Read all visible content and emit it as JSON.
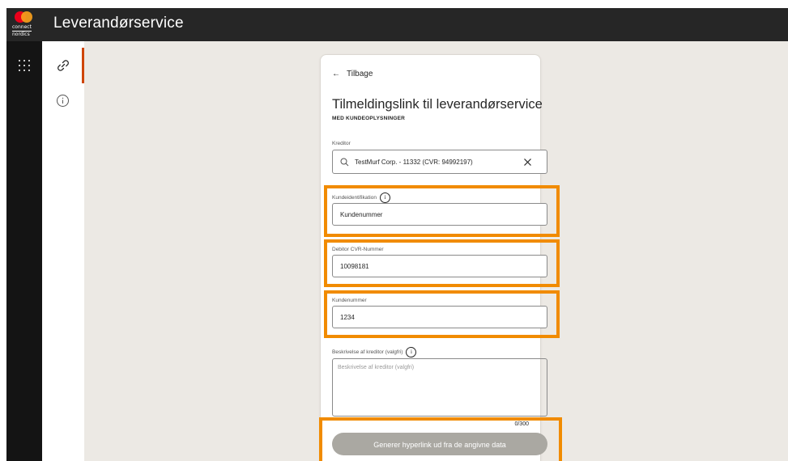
{
  "brand": {
    "line1": "connect",
    "line2": "nordics"
  },
  "app_title": "Leverandørservice",
  "colors": {
    "accent": "#cf4500",
    "highlight": "#f18b00",
    "button_disabled": "#aaa8a2"
  },
  "sidebar": {
    "items": [
      {
        "icon": "link-icon",
        "active": true
      },
      {
        "icon": "info-icon",
        "active": false
      }
    ]
  },
  "card": {
    "back_label": "Tilbage",
    "title": "Tilmeldingslink til leverandørservice",
    "subtitle": "MED KUNDEOPLYSNINGER",
    "creditor": {
      "label": "Kreditor",
      "value": "TestMurf Corp. - 11332 (CVR: 94992197)"
    },
    "customer_id": {
      "label": "Kundeidentifikation",
      "value": "Kundenummer"
    },
    "debtor_cvr": {
      "label": "Debitor CVR-Nummer",
      "value": "10098181"
    },
    "customer_number": {
      "label": "Kundenummer",
      "value": "1234"
    },
    "description": {
      "label": "Beskrivelse af kreditor (valgfri)",
      "placeholder": "Beskrivelse af kreditor (valgfri)",
      "counter": "0/300"
    },
    "generate_button": "Generer hyperlink ud fra de angivne data"
  }
}
